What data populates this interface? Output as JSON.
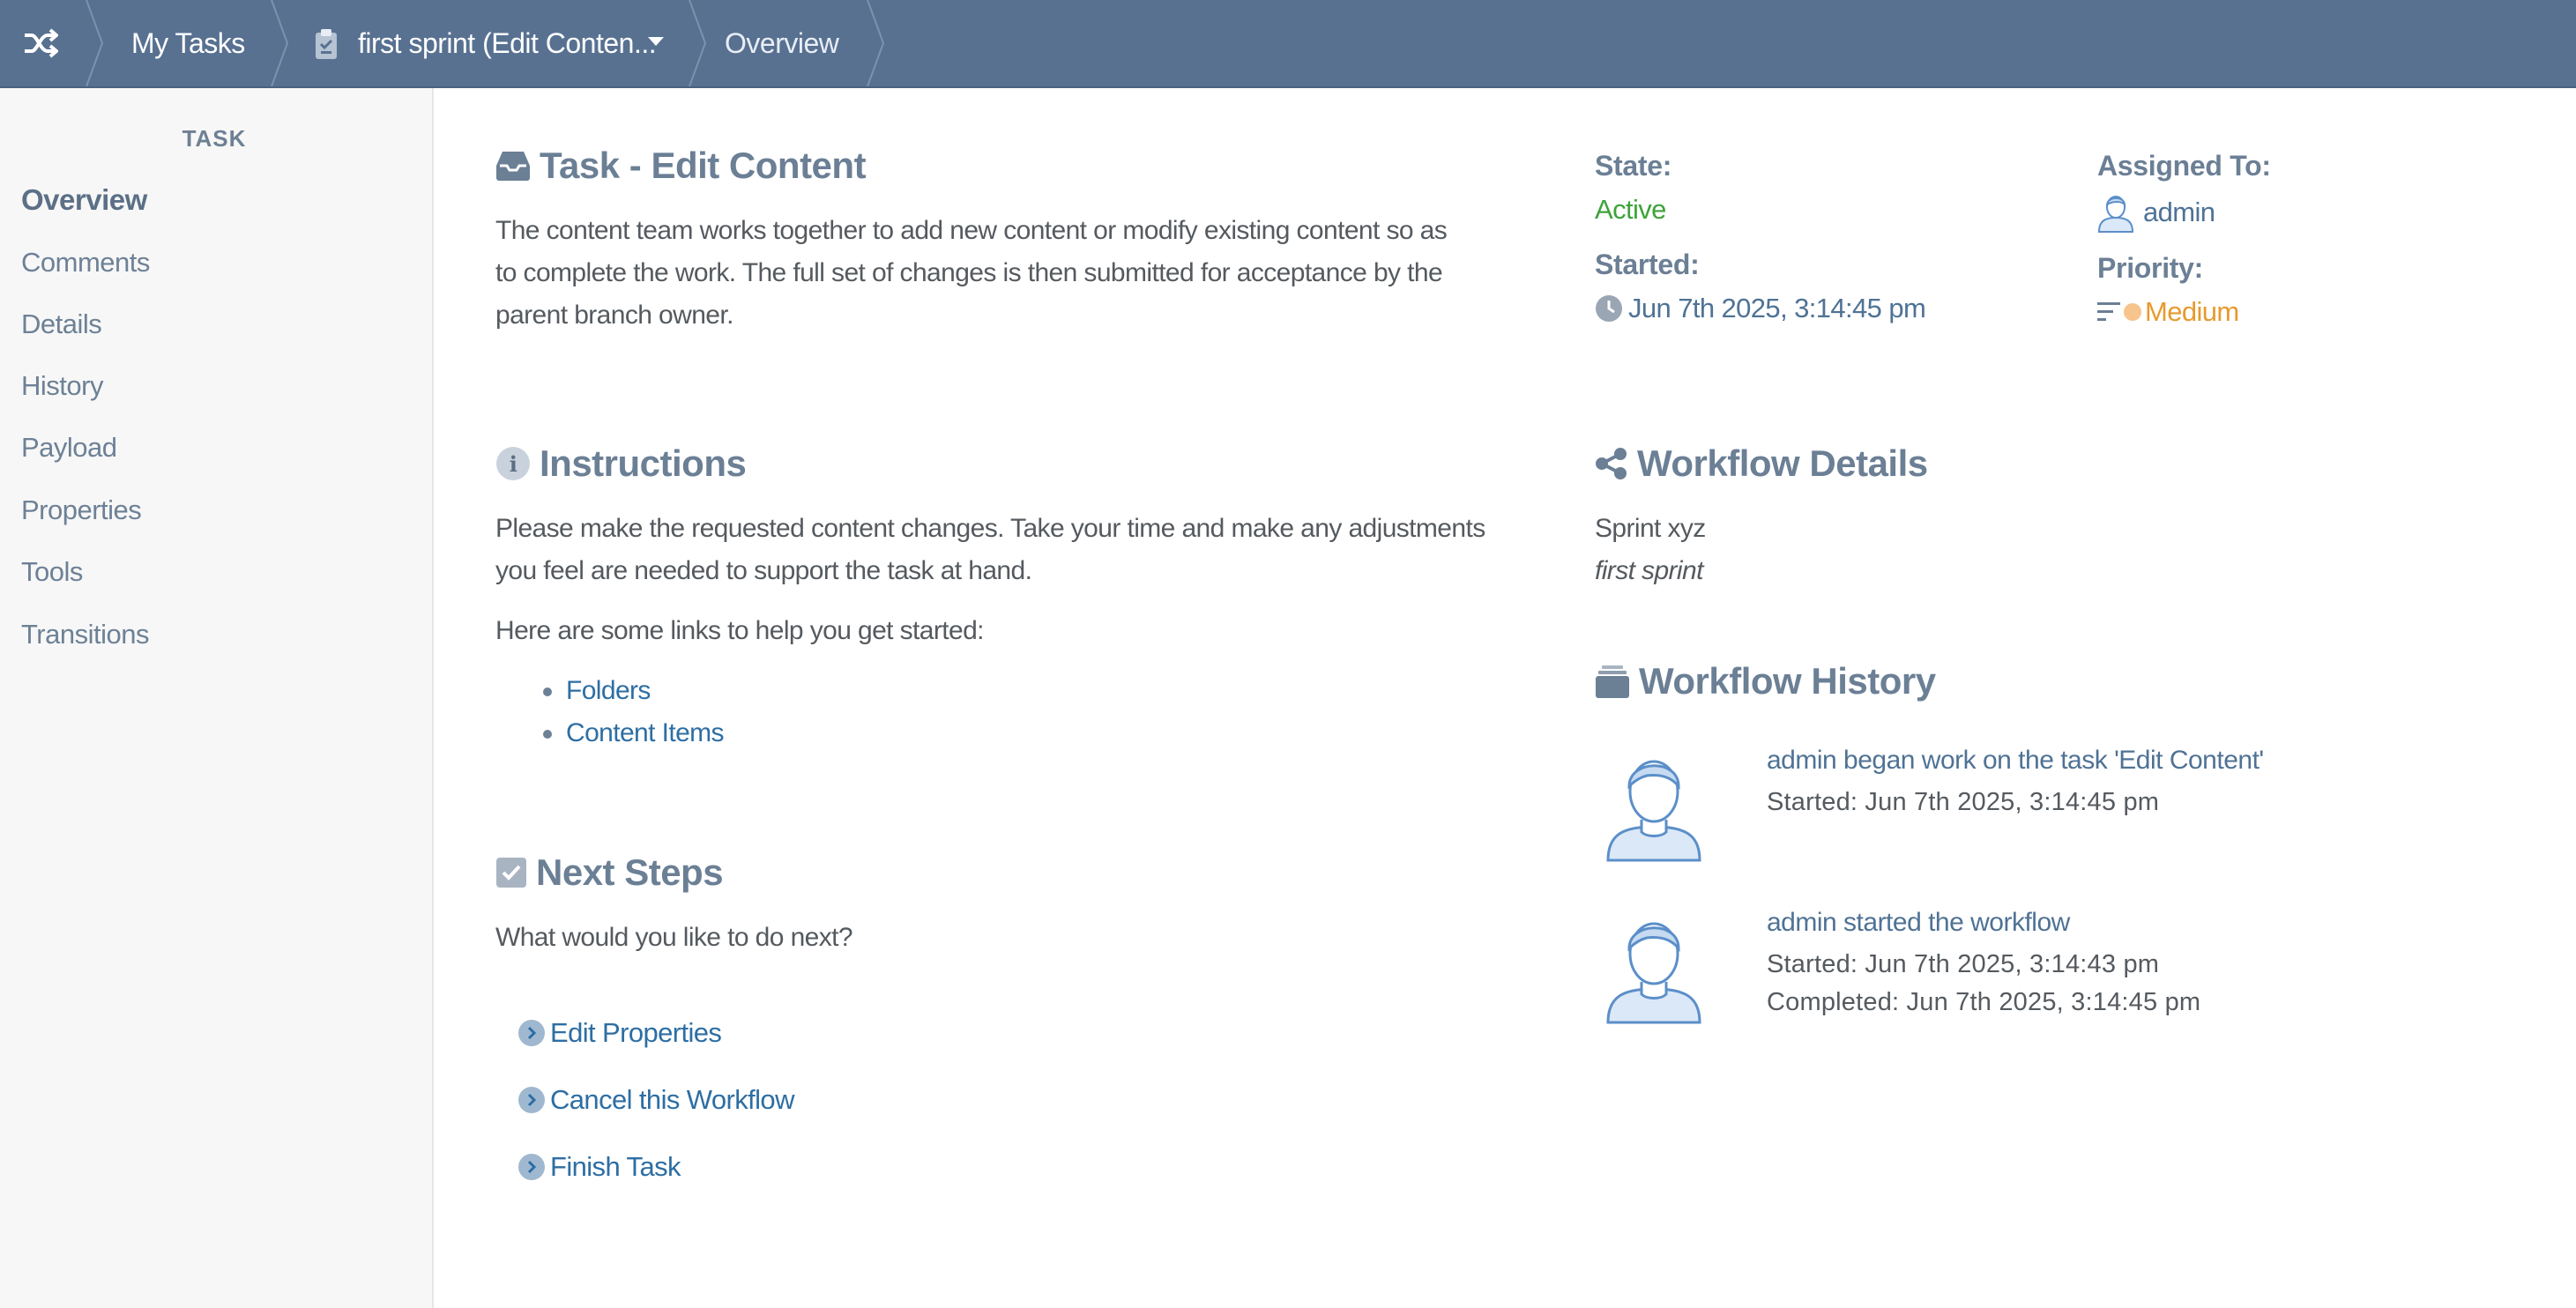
{
  "breadcrumb": {
    "home_icon": "shuffle-icon",
    "items": [
      {
        "label": "My Tasks"
      },
      {
        "label": "first sprint (Edit Conten...",
        "icon": "clipboard-icon",
        "has_dropdown": true
      },
      {
        "label": "Overview"
      }
    ]
  },
  "sidebar": {
    "heading": "TASK",
    "items": [
      {
        "label": "Overview",
        "active": true
      },
      {
        "label": "Comments"
      },
      {
        "label": "Details"
      },
      {
        "label": "History"
      },
      {
        "label": "Payload"
      },
      {
        "label": "Properties"
      },
      {
        "label": "Tools"
      },
      {
        "label": "Transitions"
      }
    ]
  },
  "task": {
    "title": "Task - Edit Content",
    "description_lines": [
      "The content team works together to add new content or modify existing content so as",
      "to complete the work. The full set of changes is then submitted for acceptance by the",
      "parent branch owner."
    ]
  },
  "instructions": {
    "title": "Instructions",
    "lines": [
      "Please make the requested content changes. Take your time and make any adjustments",
      "you feel are needed to support the task at hand."
    ],
    "links_intro": "Here are some links to help you get started:",
    "links": [
      "Folders",
      "Content Items"
    ]
  },
  "next_steps": {
    "title": "Next Steps",
    "prompt": "What would you like to do next?",
    "actions": [
      "Edit Properties",
      "Cancel this Workflow",
      "Finish Task"
    ]
  },
  "status": {
    "state_label": "State:",
    "state_value": "Active",
    "started_label": "Started:",
    "started_value": "Jun 7th 2025, 3:14:45 pm",
    "assigned_label": "Assigned To:",
    "assigned_value": "admin",
    "priority_label": "Priority:",
    "priority_value": "Medium"
  },
  "workflow_details": {
    "title": "Workflow Details",
    "name": "Sprint xyz",
    "subtitle": "first sprint"
  },
  "workflow_history": {
    "title": "Workflow History",
    "entries": [
      {
        "title": "admin began work on the task 'Edit Content'",
        "started": "Started: Jun 7th 2025, 3:14:45 pm"
      },
      {
        "title": "admin started the workflow",
        "started": "Started: Jun 7th 2025, 3:14:43 pm",
        "completed": "Completed: Jun 7th 2025, 3:14:45 pm"
      }
    ]
  },
  "colors": {
    "topbar": "#587191",
    "state_active": "#3ea33b",
    "priority_medium": "#e79a2e",
    "link": "#2d6ea3"
  }
}
